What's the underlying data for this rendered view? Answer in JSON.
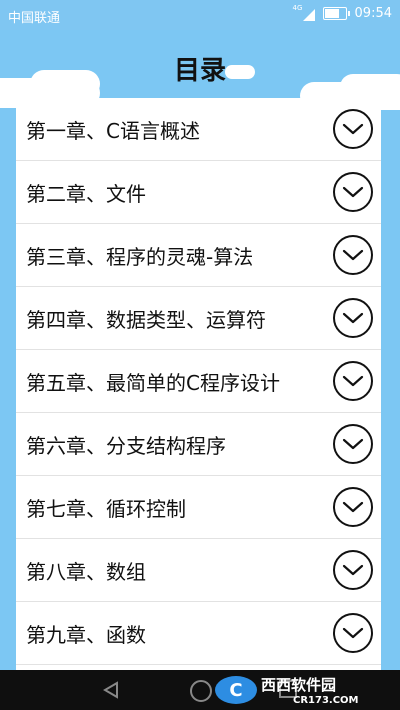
{
  "status_bar": {
    "carrier": "中国联通",
    "network": "4G",
    "time": "09:54",
    "battery_level": 0.7
  },
  "header": {
    "title": "目录"
  },
  "chapters": [
    {
      "label": "第一章、C语言概述"
    },
    {
      "label": "第二章、文件"
    },
    {
      "label": "第三章、程序的灵魂-算法"
    },
    {
      "label": "第四章、数据类型、运算符"
    },
    {
      "label": "第五章、最简单的C程序设计"
    },
    {
      "label": "第六章、分支结构程序"
    },
    {
      "label": "第七章、循环控制"
    },
    {
      "label": "第八章、数组"
    },
    {
      "label": "第九章、函数"
    }
  ],
  "expand_icon": "chevron-down-circle-icon",
  "watermark": {
    "brand": "西西软件园",
    "url": "CR173.COM"
  },
  "colors": {
    "header_bg": "#7cc7f3",
    "list_bg": "#ffffff",
    "nav_bg": "#0f0f0f"
  }
}
